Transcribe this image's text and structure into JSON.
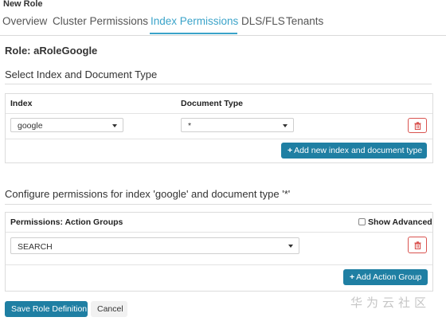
{
  "page": {
    "title": "New Role"
  },
  "tabs": [
    {
      "label": "Overview",
      "active": false
    },
    {
      "label": "Cluster Permissions",
      "active": false
    },
    {
      "label": "Index Permissions",
      "active": true
    },
    {
      "label": "DLS/FLS",
      "active": false
    },
    {
      "label": "Tenants",
      "active": false
    }
  ],
  "role": {
    "title": "Role: aRoleGoogle"
  },
  "index_section": {
    "title": "Select Index and Document Type",
    "headers": {
      "index": "Index",
      "doc_type": "Document Type"
    },
    "row": {
      "index_value": "google",
      "doc_type_value": "*"
    },
    "add_button": "Add new index and document type"
  },
  "permissions_section": {
    "title": "Configure permissions for index 'google' and document type '*'",
    "header": "Permissions: Action Groups",
    "show_advanced": {
      "label": "Show Advanced",
      "checked": false
    },
    "row": {
      "action_group_value": "SEARCH"
    },
    "add_button": "Add Action Group"
  },
  "footer": {
    "save_label": "Save Role Definition",
    "cancel_label": "Cancel"
  },
  "watermark": "华为云社区",
  "colors": {
    "accent": "#3aa3c9",
    "primary_button": "#1f7fa3",
    "danger": "#d9534f"
  },
  "icons": {
    "delete": "trash-icon",
    "add": "plus-icon",
    "dropdown": "caret-down-icon"
  }
}
